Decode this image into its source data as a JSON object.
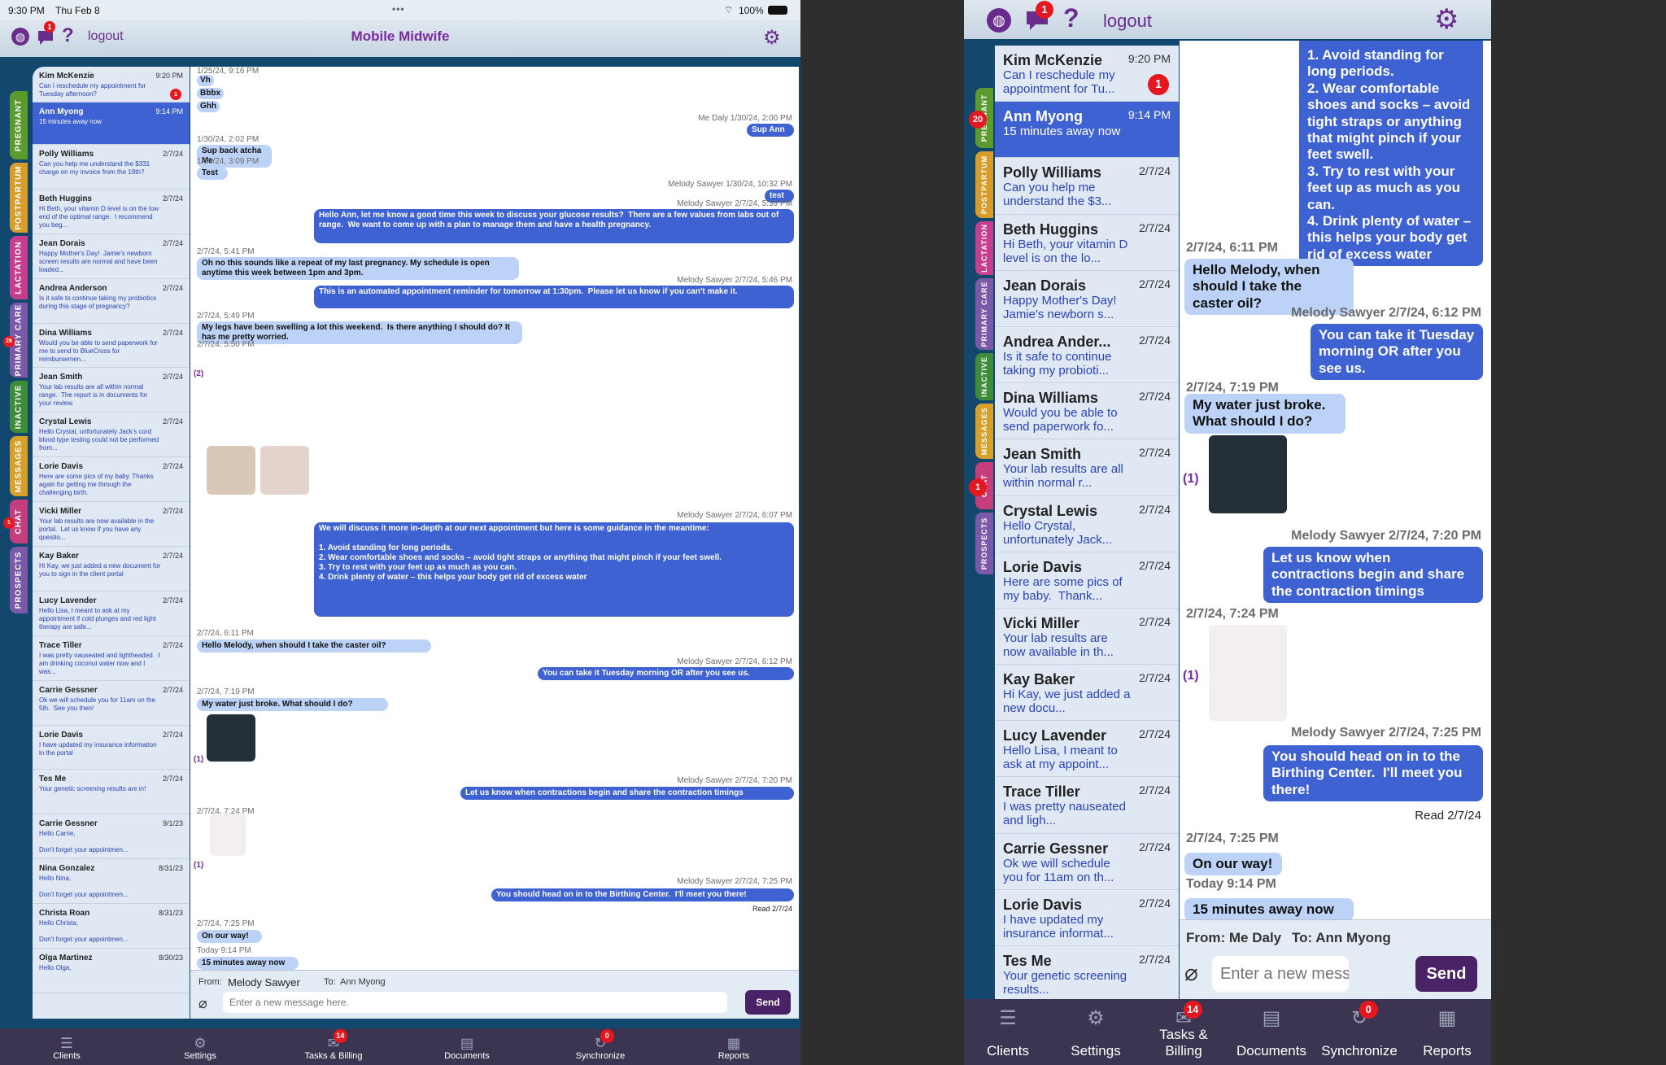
{
  "status": {
    "time": "9:30 PM",
    "date": "Thu Feb 8",
    "battery": "100%"
  },
  "app": {
    "title": "Mobile Midwife",
    "logout": "logout",
    "chat_badge": "1"
  },
  "tabs": [
    {
      "label": "PREGNANT",
      "color": "#5a9a2e"
    },
    {
      "label": "POSTPARTUM",
      "color": "#d89c2a"
    },
    {
      "label": "LACTATION",
      "color": "#c63f8e"
    },
    {
      "label": "PRIMARY CARE",
      "color": "#7a5aa8",
      "badge": "26"
    },
    {
      "label": "INACTIVE",
      "color": "#3e8c3a"
    },
    {
      "label": "MESSAGES",
      "color": "#d6a02a"
    },
    {
      "label": "CHAT",
      "color": "#c43d7c",
      "badge": "1"
    },
    {
      "label": "PROSPECTS",
      "color": "#7a5aa8"
    }
  ],
  "right_tabs": [
    {
      "label": "PREGNANT",
      "color": "#5a9a2e",
      "badge": "20"
    },
    {
      "label": "POSTPARTUM",
      "color": "#d89c2a"
    },
    {
      "label": "LACTATION",
      "color": "#c63f8e"
    },
    {
      "label": "PRIMARY CARE",
      "color": "#7a5aa8"
    },
    {
      "label": "INACTIVE",
      "color": "#3e8c3a"
    },
    {
      "label": "MESSAGES",
      "color": "#d6a02a"
    },
    {
      "label": "CHAT",
      "color": "#c43d7c",
      "badge": "1"
    },
    {
      "label": "PROSPECTS",
      "color": "#7a5aa8"
    }
  ],
  "clients": [
    {
      "name": "Kim McKenzie",
      "date": "9:20 PM",
      "preview": "Can I reschedule my appointment for Tuesday afternoon?",
      "badge": "1"
    },
    {
      "name": "Ann Myong",
      "date": "9:14 PM",
      "preview": "15 minutes away now",
      "selected": true
    },
    {
      "name": "Polly Williams",
      "date": "2/7/24",
      "preview": "Can you help me understand the $331 charge on my invoice from the 19th?"
    },
    {
      "name": "Beth Huggins",
      "date": "2/7/24",
      "preview": "Hi Beth, your vitamin D level is on the low end of the optimal range.  I recommend you beg..."
    },
    {
      "name": "Jean Dorais",
      "date": "2/7/24",
      "preview": "Happy Mother's Day!  Jamie's newborn screen results are normal and have been loaded..."
    },
    {
      "name": "Andrea Anderson",
      "date": "2/7/24",
      "preview": "Is it safe to continue taking my probiotics during this stage of pregnancy?"
    },
    {
      "name": "Dina Williams",
      "date": "2/7/24",
      "preview": "Would you be able to send paperwork for me to send to BlueCross for reimbursemen..."
    },
    {
      "name": "Jean Smith",
      "date": "2/7/24",
      "preview": "Your lab results are all within normal range.  The report is in documents for your review."
    },
    {
      "name": "Crystal Lewis",
      "date": "2/7/24",
      "preview": "Hello Crystal, unfortunately Jack's cord blood type testing could not be performed from..."
    },
    {
      "name": "Lorie Davis",
      "date": "2/7/24",
      "preview": "Here are some pics of my baby. Thanks again for getting me through the challenging birth."
    },
    {
      "name": "Vicki Miller",
      "date": "2/7/24",
      "preview": "Your lab results are now available in the portal.  Let us know if you have any questio..."
    },
    {
      "name": "Kay Baker",
      "date": "2/7/24",
      "preview": "Hi Kay, we just added a new document for you to sign in the client portal"
    },
    {
      "name": "Lucy Lavender",
      "date": "2/7/24",
      "preview": "Hello Lisa, I meant to ask at my appointment if cold plunges and red light therapy are safe..."
    },
    {
      "name": "Trace Tiller",
      "date": "2/7/24",
      "preview": "I was pretty nauseated and lightheaded.  I am drinking coconut water now and I was..."
    },
    {
      "name": "Carrie Gessner",
      "date": "2/7/24",
      "preview": "Ok we will schedule you for 11am on the 5th.  See you then!"
    },
    {
      "name": "Lorie Davis",
      "date": "2/7/24",
      "preview": "I have updated my insurance information in the portal"
    },
    {
      "name": "Tes Me",
      "date": "2/7/24",
      "preview": "Your genetic screening results are in!"
    },
    {
      "name": "Carrie Gessner",
      "date": "9/1/23",
      "preview": "Hello Carrie,\n\nDon't forget your appointmen..."
    },
    {
      "name": "Nina Gonzalez",
      "date": "8/31/23",
      "preview": "Hello Nina,\n\nDon't forget your appointmen..."
    },
    {
      "name": "Christa Roan",
      "date": "8/31/23",
      "preview": "Hello Christa,\n\nDon't forget your appointmen..."
    },
    {
      "name": "Olga Martinez",
      "date": "8/30/23",
      "preview": "Hello Olga,"
    }
  ],
  "right_clients": [
    {
      "name": "Kim McKenzie",
      "date": "9:20 PM",
      "preview": "Can I reschedule my appointment for Tu...",
      "badge": "1"
    },
    {
      "name": "Ann Myong",
      "date": "9:14 PM",
      "preview": "15 minutes away now",
      "selected": true
    },
    {
      "name": "Polly Williams",
      "date": "2/7/24",
      "preview": "Can you help me understand the $3..."
    },
    {
      "name": "Beth Huggins",
      "date": "2/7/24",
      "preview": "Hi Beth, your vitamin D level is on the lo..."
    },
    {
      "name": "Jean Dorais",
      "date": "2/7/24",
      "preview": "Happy Mother's Day! Jamie's newborn s..."
    },
    {
      "name": "Andrea Ander...",
      "date": "2/7/24",
      "preview": "Is it safe to continue taking my probioti..."
    },
    {
      "name": "Dina Williams",
      "date": "2/7/24",
      "preview": "Would you be able to send paperwork fo..."
    },
    {
      "name": "Jean Smith",
      "date": "2/7/24",
      "preview": "Your lab results are all within normal r..."
    },
    {
      "name": "Crystal Lewis",
      "date": "2/7/24",
      "preview": "Hello Crystal, unfortunately Jack..."
    },
    {
      "name": "Lorie Davis",
      "date": "2/7/24",
      "preview": "Here are some pics of my baby.  Thank..."
    },
    {
      "name": "Vicki Miller",
      "date": "2/7/24",
      "preview": "Your lab results are now available in th..."
    },
    {
      "name": "Kay Baker",
      "date": "2/7/24",
      "preview": "Hi Kay, we just added a new docu..."
    },
    {
      "name": "Lucy Lavender",
      "date": "2/7/24",
      "preview": "Hello Lisa, I meant to ask at my appoint..."
    },
    {
      "name": "Trace Tiller",
      "date": "2/7/24",
      "preview": "I was pretty nauseated and ligh..."
    },
    {
      "name": "Carrie Gessner",
      "date": "2/7/24",
      "preview": "Ok we will schedule you for 11am on th..."
    },
    {
      "name": "Lorie Davis",
      "date": "2/7/24",
      "preview": "I have updated my insurance informat..."
    },
    {
      "name": "Tes Me",
      "date": "2/7/24",
      "preview": "Your genetic screening results..."
    }
  ],
  "messages": [
    {
      "side": "in",
      "meta": "1/25/24, 9:16 PM",
      "items": [
        "Vh",
        "Bbbx",
        "Ghh"
      ]
    },
    {
      "side": "out",
      "meta": "Me Daly   1/30/24, 2:00 PM",
      "text": "Sup Ann"
    },
    {
      "side": "in",
      "meta": "1/30/24, 2:02 PM",
      "text": "Sup back atcha Me"
    },
    {
      "side": "in",
      "meta": "1/30/24, 3:09 PM",
      "text": "Test"
    },
    {
      "side": "out",
      "meta": "Melody Sawyer   1/30/24, 10:32 PM",
      "text": "test"
    },
    {
      "side": "out",
      "meta": "Melody Sawyer   2/7/24, 5:39 PM",
      "text": "Hello Ann, let me know a good time this week to discuss your glucose results?  There are a few values from labs out of range.  We want to come up with a plan to manage them and have a health pregnancy."
    },
    {
      "side": "in",
      "meta": "2/7/24, 5:41 PM",
      "text": "Oh no this sounds like a repeat of my last pregnancy. My schedule is open anytime this week between 1pm and 3pm."
    },
    {
      "side": "out",
      "meta": "Melody Sawyer   2/7/24, 5:46 PM",
      "text": "This is an automated appointment reminder for tomorrow at 1:30pm.  Please let us know if you can't make it."
    },
    {
      "side": "in",
      "meta": "2/7/24, 5:49 PM",
      "text": "My legs have been swelling a lot this weekend.  Is there anything I should do? It has me pretty worried."
    },
    {
      "side": "in",
      "meta": "2/7/24, 5:50 PM",
      "count": "(2)"
    },
    {
      "side": "out",
      "meta": "Melody Sawyer   2/7/24, 6:07 PM",
      "text": "We will discuss it more in-depth at our next appointment but here is some guidance in the meantime:\n\n1. Avoid standing for long periods.\n2. Wear comfortable shoes and socks – avoid tight straps or anything that might pinch if your feet swell.\n3. Try to rest with your feet up as much as you can.\n4. Drink plenty of water – this helps your body get rid of excess water"
    },
    {
      "side": "in",
      "meta": "2/7/24, 6:11 PM",
      "text": "Hello Melody, when should I take the caster oil?"
    },
    {
      "side": "out",
      "meta": "Melody Sawyer   2/7/24, 6:12 PM",
      "text": "You can take it Tuesday morning OR after you see us."
    },
    {
      "side": "in",
      "meta": "2/7/24, 7:19 PM",
      "text": "My water just broke. What should I do?"
    },
    {
      "side": "in",
      "count": "(1)"
    },
    {
      "side": "out",
      "meta": "Melody Sawyer   2/7/24, 7:20 PM",
      "text": "Let us know when contractions begin and share the contraction timings"
    },
    {
      "side": "in",
      "meta": "2/7/24, 7:24 PM",
      "count": "(1)"
    },
    {
      "side": "out",
      "meta": "Melody Sawyer   2/7/24, 7:25 PM",
      "text": "You should head on in to the Birthing Center.  I'll meet you there!",
      "read": "Read 2/7/24"
    },
    {
      "side": "in",
      "meta": "2/7/24, 7:25 PM",
      "text": "On our way!"
    },
    {
      "side": "in",
      "meta": "Today 9:14 PM",
      "text": "15 minutes away now"
    }
  ],
  "right_messages": {
    "top_text": "1. Avoid standing for long periods.\n2. Wear comfortable shoes and socks – avoid tight straps or anything that might pinch if your feet swell.\n3. Try to rest with your feet up as much as you can.\n4. Drink plenty of water – this helps your body get rid of excess water",
    "top_partial": "1. Avoid standing for",
    "m1_meta": "2/7/24, 6:11 PM",
    "m1": "Hello Melody, when should I take the caster oil?",
    "m2_meta": "Melody Sawyer   2/7/24, 6:12 PM",
    "m2": "You can take it Tuesday morning OR after you see us.",
    "m3_meta": "2/7/24, 7:19 PM",
    "m3": "My water just broke. What should I do?",
    "c1": "(1)",
    "m4_meta": "Melody Sawyer   2/7/24, 7:20 PM",
    "m4": "Let us know when contractions begin and share the contraction timings",
    "m5_meta": "2/7/24, 7:24 PM",
    "c2": "(1)",
    "m6_meta": "Melody Sawyer   2/7/24, 7:25 PM",
    "m6": "You should head on in to the Birthing Center.  I'll meet you there!",
    "read": "Read 2/7/24",
    "m7_meta": "2/7/24, 7:25 PM",
    "m7": "On our way!",
    "m8_meta": "Today 9:14 PM",
    "m8": "15 minutes away now"
  },
  "compose": {
    "from_label": "From:",
    "from": "Melody Sawyer",
    "to_label": "To:",
    "to": "Ann Myong",
    "placeholder": "Enter a new message here.",
    "send": "Send"
  },
  "right_compose": {
    "from": "From: Me Daly",
    "to": "To: Ann Myong",
    "placeholder": "Enter a new messa",
    "send": "Send"
  },
  "bottom": [
    {
      "label": "Clients",
      "icon": "clients-icon"
    },
    {
      "label": "Settings",
      "icon": "gear-icon"
    },
    {
      "label": "Tasks & Billing",
      "icon": "tasks-icon",
      "badge": "14"
    },
    {
      "label": "Documents",
      "icon": "documents-icon"
    },
    {
      "label": "Synchronize",
      "icon": "sync-icon",
      "badge": "0"
    },
    {
      "label": "Reports",
      "icon": "reports-icon"
    }
  ]
}
